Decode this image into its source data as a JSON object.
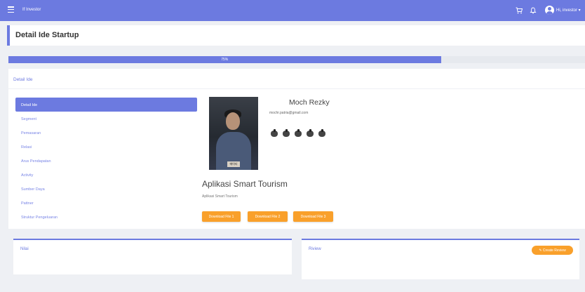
{
  "topbar": {
    "menu_icon": "hamburger-icon",
    "brand": "If Investor",
    "cart_icon": "cart-icon",
    "bell_icon": "bell-icon",
    "avatar_icon": "user-avatar-icon",
    "user_label": "Hi, investor ▾"
  },
  "page": {
    "title": "Detail Ide Startup"
  },
  "progress": {
    "value_percent": 75,
    "label": "75%",
    "color": "#6c7ae0"
  },
  "detail": {
    "card_title": "Detail Ide",
    "menu": [
      {
        "label": "Detail Ide",
        "active": true
      },
      {
        "label": "Segment",
        "active": false
      },
      {
        "label": "Pemasaran",
        "active": false
      },
      {
        "label": "Relasi",
        "active": false
      },
      {
        "label": "Arus Pendapatan",
        "active": false
      },
      {
        "label": "Activity",
        "active": false
      },
      {
        "label": "Sumber Daya",
        "active": false
      },
      {
        "label": "Pattner",
        "active": false
      },
      {
        "label": "Struktur Pengeluaran",
        "active": false
      }
    ],
    "profile": {
      "name": "Moch Rezky",
      "email": "mochr.patria@gmail.com",
      "icons": [
        "hand-icon",
        "hand-icon",
        "hand-icon",
        "hand-icon",
        "hand-icon"
      ],
      "photo_caption": "에이티"
    },
    "startup_name": "Aplikasi Smart Tourism",
    "startup_desc": "Aplikasi Smart Tourism",
    "buttons": [
      "Download File 1",
      "Download File 2",
      "Download File 3"
    ]
  },
  "nilai": {
    "title": "Nilai"
  },
  "review": {
    "title": "Riview",
    "button": "✎ Create Review"
  },
  "colors": {
    "accent": "#6c7ae0",
    "button": "#f9a02b",
    "background": "#eef0f4"
  }
}
